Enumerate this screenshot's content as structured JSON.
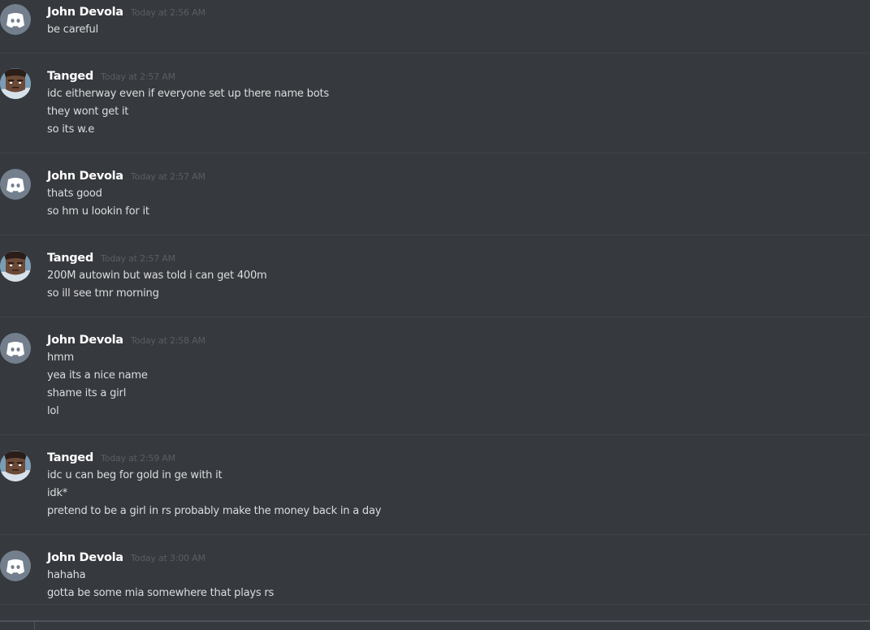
{
  "colors": {
    "background": "#36393e",
    "username": "#ffffff",
    "timestamp": "#5a5d63",
    "message_text": "#dcddde",
    "default_avatar": "#747f8d"
  },
  "messages": [
    {
      "author": "John Devola",
      "avatar": "discord-default-icon",
      "timestamp": "Today at 2:56 AM",
      "lines": [
        "be careful"
      ]
    },
    {
      "author": "Tanged",
      "avatar": "custom-avatar-image",
      "timestamp": "Today at 2:57 AM",
      "lines": [
        "idc eitherway even if everyone set up there name bots",
        "they wont get it",
        "so its w.e"
      ]
    },
    {
      "author": "John Devola",
      "avatar": "discord-default-icon",
      "timestamp": "Today at 2:57 AM",
      "lines": [
        "thats good",
        "so hm u lookin for it"
      ]
    },
    {
      "author": "Tanged",
      "avatar": "custom-avatar-image",
      "timestamp": "Today at 2:57 AM",
      "lines": [
        "200M autowin but was told i can get 400m",
        "so ill see tmr morning"
      ]
    },
    {
      "author": "John Devola",
      "avatar": "discord-default-icon",
      "timestamp": "Today at 2:58 AM",
      "lines": [
        "hmm",
        "yea its a nice name",
        "shame its a girl",
        "lol"
      ]
    },
    {
      "author": "Tanged",
      "avatar": "custom-avatar-image",
      "timestamp": "Today at 2:59 AM",
      "lines": [
        "idc u can beg for gold in ge with it",
        "idk*",
        "pretend to be a girl in rs probably make the money back in a day"
      ]
    },
    {
      "author": "John Devola",
      "avatar": "discord-default-icon",
      "timestamp": "Today at 3:00 AM",
      "lines": [
        "hahaha",
        "gotta be some mia somewhere that plays rs"
      ]
    }
  ]
}
